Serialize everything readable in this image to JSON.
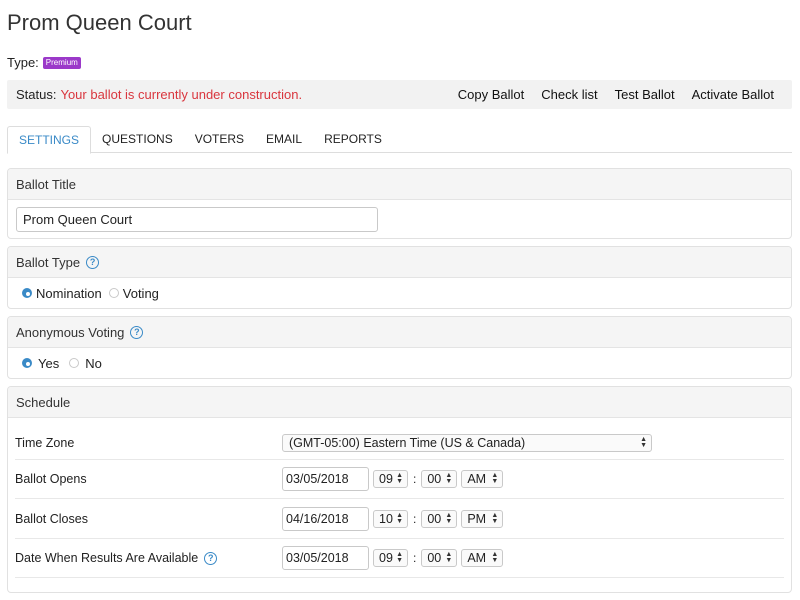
{
  "page": {
    "title": "Prom Queen Court"
  },
  "type_row": {
    "label": "Type:",
    "badge": "Premium"
  },
  "status": {
    "label": "Status:",
    "text": "Your ballot is currently under construction.",
    "actions": [
      "Copy Ballot",
      "Check list",
      "Test Ballot",
      "Activate Ballot"
    ]
  },
  "tabs": [
    "SETTINGS",
    "QUESTIONS",
    "VOTERS",
    "EMAIL",
    "REPORTS"
  ],
  "ballot_title": {
    "header": "Ballot Title",
    "value": "Prom Queen Court"
  },
  "ballot_type": {
    "header": "Ballot Type",
    "options": [
      "Nomination",
      "Voting"
    ],
    "selected": "Nomination"
  },
  "anonymous": {
    "header": "Anonymous Voting",
    "options": [
      "Yes",
      "No"
    ],
    "selected": "Yes"
  },
  "schedule": {
    "header": "Schedule",
    "timezone_label": "Time Zone",
    "timezone_value": "(GMT-05:00) Eastern Time (US & Canada)",
    "opens": {
      "label": "Ballot Opens",
      "date": "03/05/2018",
      "hour": "09",
      "minute": "00",
      "ampm": "AM"
    },
    "closes": {
      "label": "Ballot Closes",
      "date": "04/16/2018",
      "hour": "10",
      "minute": "00",
      "ampm": "PM"
    },
    "results": {
      "label": "Date When Results Are Available",
      "date": "03/05/2018",
      "hour": "09",
      "minute": "00",
      "ampm": "AM"
    },
    "colon": ":"
  },
  "icons": {
    "help": "help-circle-icon",
    "select_arrows": "updown-arrows-icon"
  },
  "colors": {
    "accent": "#3a8ac7",
    "status_error": "#d9363e",
    "badge": "#9b39c9"
  }
}
